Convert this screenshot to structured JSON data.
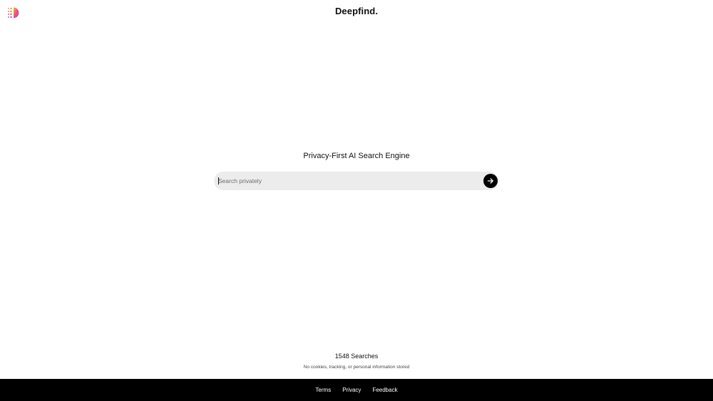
{
  "header": {
    "brand": "Deepfind.",
    "logo_icon": "dot-grid-gradient-logo-icon"
  },
  "main": {
    "tagline": "Privacy-First AI Search Engine",
    "search": {
      "placeholder": "Search privately",
      "value": "",
      "submit_icon": "arrow-right-icon"
    }
  },
  "stats": {
    "count_text": "1548 Searches",
    "notice": "No cookies, tracking, or personal information stored"
  },
  "footer": {
    "links": [
      "Terms",
      "Privacy",
      "Feedback"
    ]
  },
  "colors": {
    "footer_bg": "#000000",
    "search_bg": "#ececec",
    "button_bg": "#000000",
    "logo_gradient": [
      "#f5b63b",
      "#f0506e",
      "#8a5cf6"
    ]
  }
}
